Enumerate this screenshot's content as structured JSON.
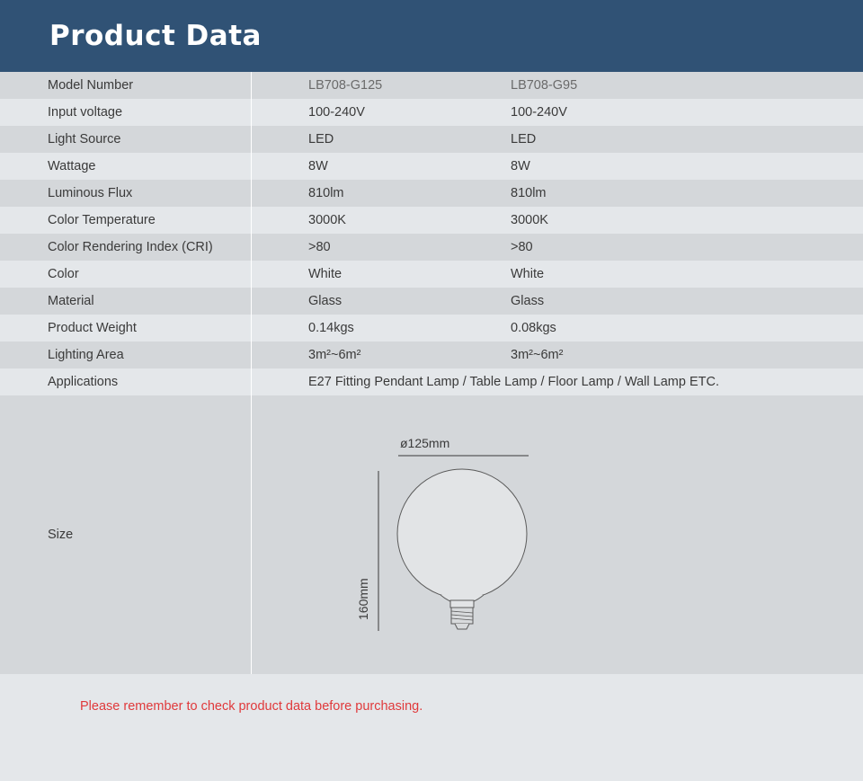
{
  "header": {
    "title": "Product Data"
  },
  "rows": [
    {
      "label": "Model Number",
      "a": "LB708-G125",
      "b": "LB708-G95"
    },
    {
      "label": "Input voltage",
      "a": "100-240V",
      "b": "100-240V"
    },
    {
      "label": "Light Source",
      "a": "LED",
      "b": "LED"
    },
    {
      "label": "Wattage",
      "a": "8W",
      "b": "8W"
    },
    {
      "label": "Luminous Flux",
      "a": "810lm",
      "b": "810lm"
    },
    {
      "label": "Color Temperature",
      "a": "3000K",
      "b": "3000K"
    },
    {
      "label": "Color Rendering Index (CRI)",
      "a": ">80",
      "b": ">80"
    },
    {
      "label": "Color",
      "a": "White",
      "b": "White"
    },
    {
      "label": "Material",
      "a": "Glass",
      "b": "Glass"
    },
    {
      "label": "Product Weight",
      "a": "0.14kgs",
      "b": "0.08kgs"
    },
    {
      "label": "Lighting Area",
      "a": "3m²~6m²",
      "b": "3m²~6m²"
    }
  ],
  "applications": {
    "label": "Applications",
    "value": "E27 Fitting Pendant Lamp / Table Lamp / Floor Lamp / Wall Lamp ETC."
  },
  "size": {
    "label": "Size",
    "width_label": "ø125mm",
    "height_label": "160mm"
  },
  "notice": "Please remember to check product data before purchasing.",
  "colors": {
    "header_bg": "#305275",
    "notice": "#e0393b"
  }
}
